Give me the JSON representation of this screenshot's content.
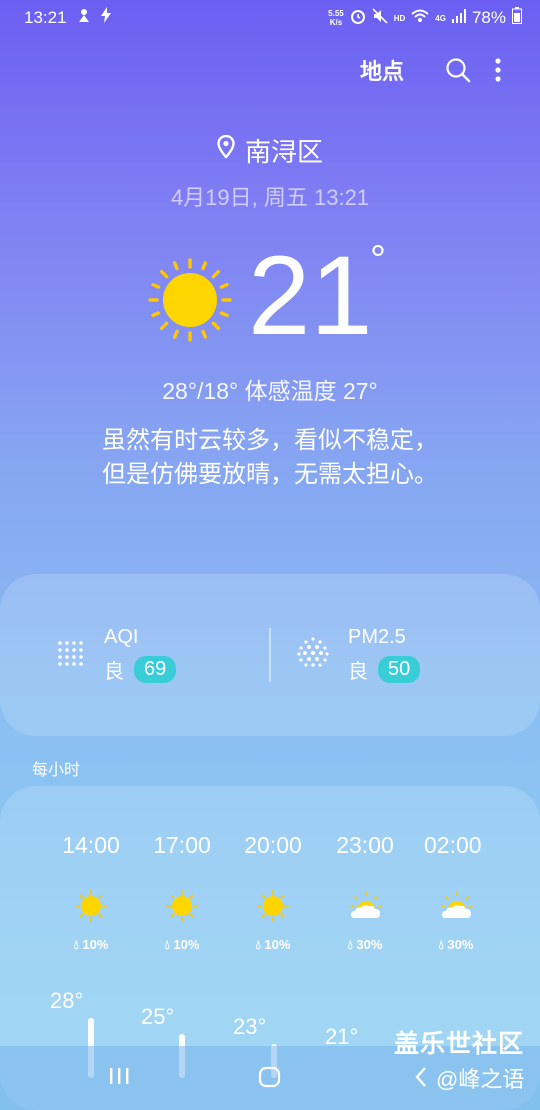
{
  "status": {
    "time": "13:21",
    "net_speed_value": "5.55",
    "net_speed_unit": "K/s",
    "hd": "HD",
    "signal_gen": "4G",
    "battery": "78%"
  },
  "toolbar": {
    "places_label": "地点",
    "search_icon": "search-icon",
    "more_icon": "more-vert-icon"
  },
  "location": {
    "name": "南浔区"
  },
  "datetime": "4月19日, 周五 13:21",
  "current": {
    "temp": "21",
    "degree": "°",
    "hilo": "28°/18° 体感温度 27°",
    "description_line1": "虽然有时云较多，看似不稳定，",
    "description_line2": "但是仿佛要放晴，无需太担心。"
  },
  "air_quality": {
    "aqi": {
      "name": "AQI",
      "level": "良",
      "value": "69"
    },
    "pm25": {
      "name": "PM2.5",
      "level": "良",
      "value": "50"
    }
  },
  "hourly": {
    "label": "每小时",
    "items": [
      {
        "time": "14:00",
        "icon": "sunny",
        "rain": "10%",
        "temp": "28°"
      },
      {
        "time": "17:00",
        "icon": "sunny",
        "rain": "10%",
        "temp": "25°"
      },
      {
        "time": "20:00",
        "icon": "sunny",
        "rain": "10%",
        "temp": "23°"
      },
      {
        "time": "23:00",
        "icon": "partly-cloudy",
        "rain": "30%",
        "temp": "21°"
      },
      {
        "time": "02:00",
        "icon": "partly-cloudy",
        "rain": "30%",
        "temp": ""
      }
    ]
  },
  "colors": {
    "accent_badge": "#39cdd8",
    "sun": "#ffd500",
    "sun_rays": "#ffc800"
  },
  "watermark": {
    "line1": "盖乐世社区",
    "line2": "@峰之语"
  }
}
